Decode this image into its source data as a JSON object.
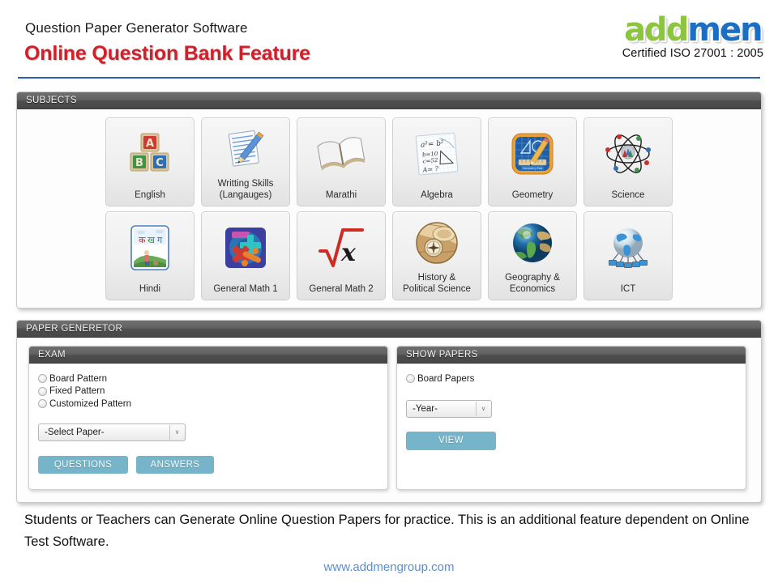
{
  "header": {
    "subtitle": "Question Paper Generator Software",
    "title": "Online Question Bank Feature",
    "logo_part1": "add",
    "logo_part2": "men",
    "certification": "Certified ISO 27001 : 2005",
    "accent_red": "#d2202b",
    "logo_green": "#8cc63e",
    "logo_blue": "#1a6fc4",
    "rule_color": "#2f5fa8"
  },
  "subjects": {
    "panel_title": "SUBJECTS",
    "rows": [
      [
        {
          "label": "English",
          "icon": "abc-blocks-icon"
        },
        {
          "label": "Writting Skills\n(Langauges)",
          "line1": "Writting Skills",
          "line2": "(Langauges)",
          "icon": "notepad-pencil-icon"
        },
        {
          "label": "Marathi",
          "icon": "open-book-icon"
        },
        {
          "label": "Algebra",
          "icon": "algebra-notes-icon"
        },
        {
          "label": "Geometry",
          "icon": "geometry-pad-icon"
        },
        {
          "label": "Science",
          "icon": "atom-icon"
        }
      ],
      [
        {
          "label": "Hindi",
          "icon": "devanagari-chart-icon"
        },
        {
          "label": "General Math 1",
          "icon": "math-symbols-icon"
        },
        {
          "label": "General Math 2",
          "icon": "radical-x-icon"
        },
        {
          "label": "History &\nPolitical Science",
          "line1": "History &",
          "line2": "Political Science",
          "icon": "compass-map-icon"
        },
        {
          "label": "Geography &\nEconomics",
          "line1": "Geography &",
          "line2": "Economics",
          "icon": "globe-earth-icon"
        },
        {
          "label": "ICT",
          "icon": "globe-network-icon"
        }
      ]
    ],
    "hindi_letters": [
      "क",
      "ख",
      "ग"
    ]
  },
  "generator": {
    "panel_title": "PAPER GENERETOR",
    "exam": {
      "panel_title": "EXAM",
      "radios": [
        {
          "label": "Board Pattern",
          "selected": false
        },
        {
          "label": "Fixed Pattern",
          "selected": false
        },
        {
          "label": "Customized Pattern",
          "selected": false
        }
      ],
      "select": {
        "value": "-Select Paper-",
        "arrow": "∨"
      },
      "buttons": [
        {
          "label": "QUESTIONS"
        },
        {
          "label": "ANSWERS"
        }
      ]
    },
    "show_papers": {
      "panel_title": "SHOW PAPERS",
      "radios": [
        {
          "label": "Board Papers",
          "selected": false
        }
      ],
      "select": {
        "value": "-Year-",
        "arrow": "∨"
      },
      "buttons": [
        {
          "label": "VIEW"
        }
      ]
    },
    "button_color": "#76b5c9"
  },
  "caption": "Students or Teachers can Generate Online Question Papers for practice. This is an additional feature dependent on Online Test Software.",
  "footer_url": "www.addmengroup.com"
}
